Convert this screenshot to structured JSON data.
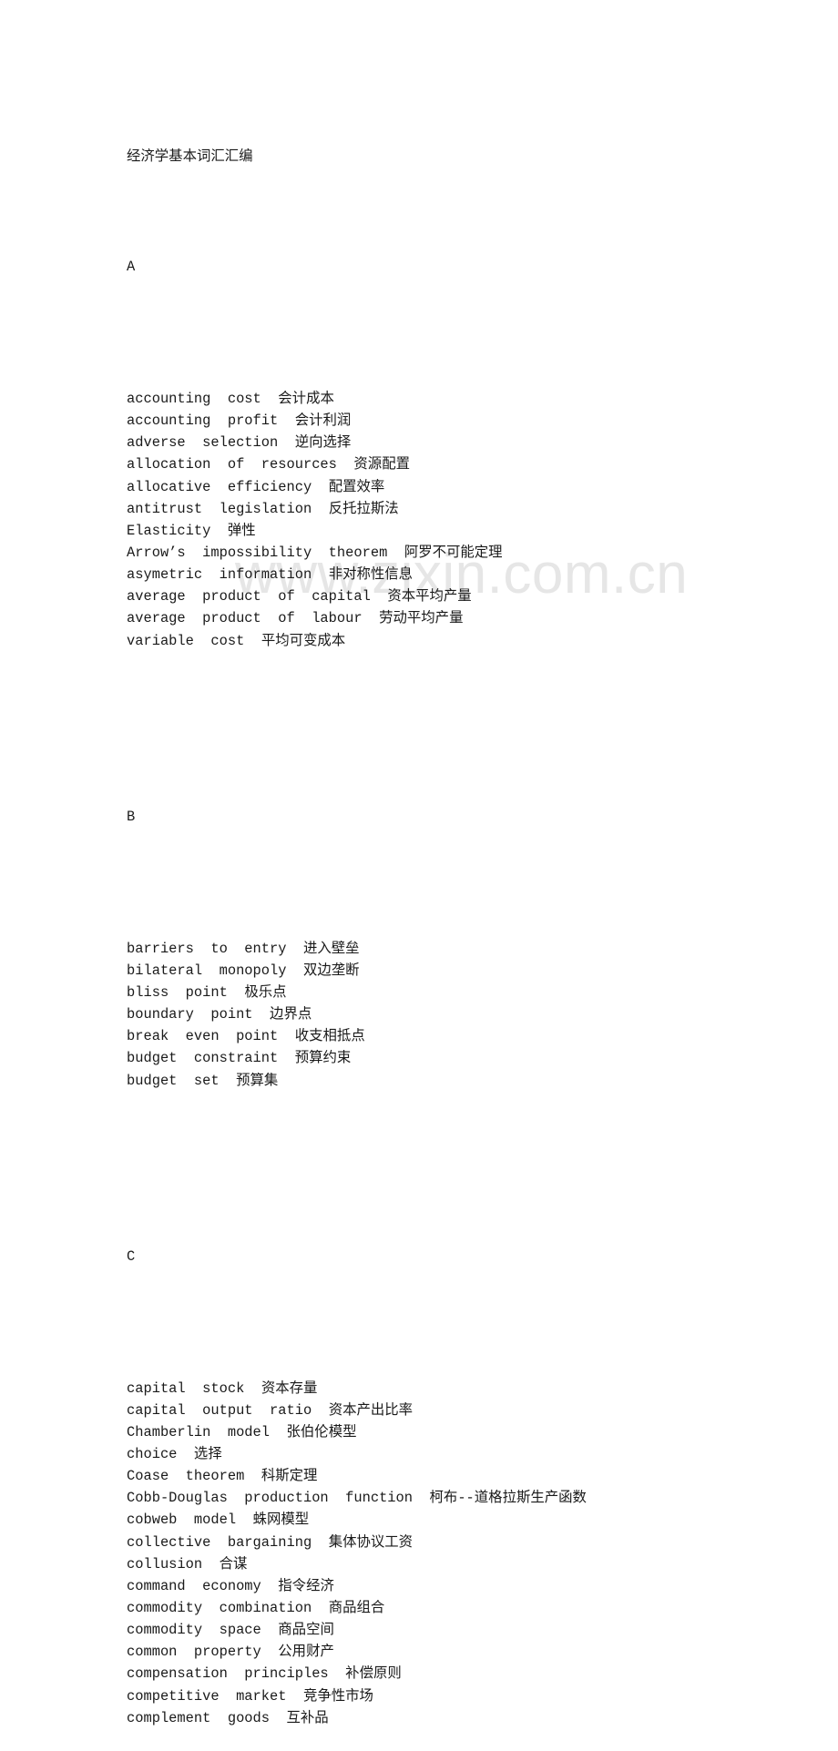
{
  "document": {
    "title": "经济学基本词汇汇编",
    "watermark": "www.zixin.com.cn",
    "sections": [
      {
        "letter": "A",
        "entries": [
          {
            "en": "accounting  cost",
            "zh": "会计成本"
          },
          {
            "en": "accounting  profit",
            "zh": "会计利润"
          },
          {
            "en": "adverse  selection",
            "zh": "逆向选择"
          },
          {
            "en": "allocation  of  resources",
            "zh": "资源配置"
          },
          {
            "en": "allocative  efficiency",
            "zh": "配置效率"
          },
          {
            "en": "antitrust  legislation",
            "zh": "反托拉斯法"
          },
          {
            "en": "Elasticity",
            "zh": "弹性"
          },
          {
            "en": "Arrow’s  impossibility  theorem",
            "zh": "阿罗不可能定理"
          },
          {
            "en": "asymetric  information",
            "zh": "非对称性信息"
          },
          {
            "en": "average  product  of  capital",
            "zh": "资本平均产量"
          },
          {
            "en": "average  product  of  labour",
            "zh": "劳动平均产量"
          },
          {
            "en": "variable  cost",
            "zh": "平均可变成本"
          }
        ]
      },
      {
        "letter": "B",
        "entries": [
          {
            "en": "barriers  to  entry",
            "zh": "进入壁垒"
          },
          {
            "en": "bilateral  monopoly",
            "zh": "双边垄断"
          },
          {
            "en": "bliss  point",
            "zh": "极乐点"
          },
          {
            "en": "boundary  point",
            "zh": "边界点"
          },
          {
            "en": "break  even  point",
            "zh": "收支相抵点"
          },
          {
            "en": "budget  constraint",
            "zh": "预算约束"
          },
          {
            "en": "budget  set",
            "zh": "预算集"
          }
        ]
      },
      {
        "letter": "C",
        "entries": [
          {
            "en": "capital  stock",
            "zh": "资本存量"
          },
          {
            "en": "capital  output  ratio",
            "zh": "资本产出比率"
          },
          {
            "en": "Chamberlin  model",
            "zh": "张伯伦模型"
          },
          {
            "en": "choice",
            "zh": "选择"
          },
          {
            "en": "Coase  theorem",
            "zh": "科斯定理"
          },
          {
            "en": "Cobb-Douglas  production  function",
            "zh": "柯布--道格拉斯生产函数"
          },
          {
            "en": "cobweb  model",
            "zh": "蛛网模型"
          },
          {
            "en": "collective  bargaining",
            "zh": "集体协议工资"
          },
          {
            "en": "collusion",
            "zh": "合谋"
          },
          {
            "en": "command  economy",
            "zh": "指令经济"
          },
          {
            "en": "commodity  combination",
            "zh": "商品组合"
          },
          {
            "en": "commodity  space",
            "zh": "商品空间"
          },
          {
            "en": "common  property",
            "zh": "公用财产"
          },
          {
            "en": "compensation  principles",
            "zh": "补偿原则"
          },
          {
            "en": "competitive  market",
            "zh": "竞争性市场"
          },
          {
            "en": "complement  goods",
            "zh": "互补品"
          }
        ]
      }
    ]
  }
}
